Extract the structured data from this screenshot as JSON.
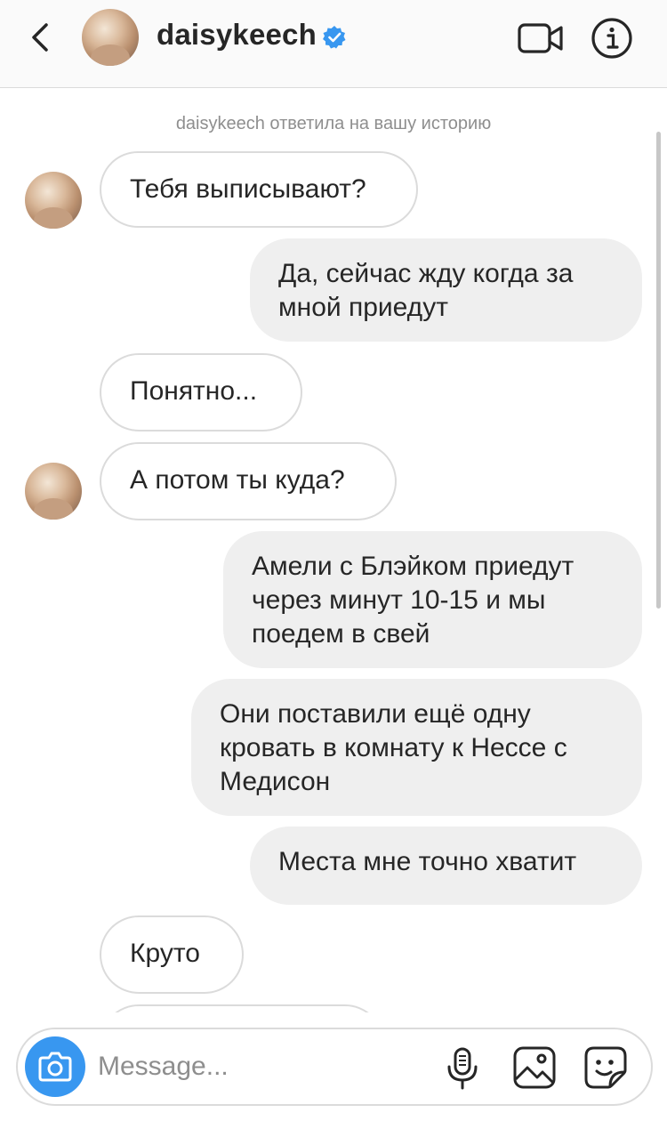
{
  "header": {
    "username": "daisykeech",
    "verified": true,
    "icons": {
      "back": "chevron-left-icon",
      "verified": "verified-badge-icon",
      "video": "video-camera-icon",
      "info": "info-icon"
    }
  },
  "chat": {
    "story_reply_note": "daisykeech ответила на вашу историю",
    "messages": [
      {
        "sender": "them",
        "text": "Тебя выписывают?",
        "show_avatar": true
      },
      {
        "sender": "me",
        "text": "Да, сейчас жду когда за мной приедут"
      },
      {
        "sender": "them",
        "text": "Понятно...",
        "show_avatar": false
      },
      {
        "sender": "them",
        "text": "А потом ты куда?",
        "show_avatar": true
      },
      {
        "sender": "me",
        "text": "Амели с Блэйком приедут через минут 10-15 и мы поедем в свей"
      },
      {
        "sender": "me",
        "text": "Они поставили ещё одну кровать в комнату к Нессе с Медисон"
      },
      {
        "sender": "me",
        "text": "Места мне точно хватит"
      },
      {
        "sender": "them",
        "text": "Круто",
        "show_avatar": false
      }
    ]
  },
  "composer": {
    "placeholder": "Message...",
    "icons": {
      "camera": "camera-icon",
      "mic": "microphone-icon",
      "gallery": "image-icon",
      "sticker": "sticker-icon"
    }
  },
  "colors": {
    "accent_blue": "#3897f0",
    "verified_blue": "#3897f0",
    "outgoing_bubble": "#efefef",
    "incoming_border": "#dbdbdb",
    "muted_text": "#8e8e8e"
  }
}
